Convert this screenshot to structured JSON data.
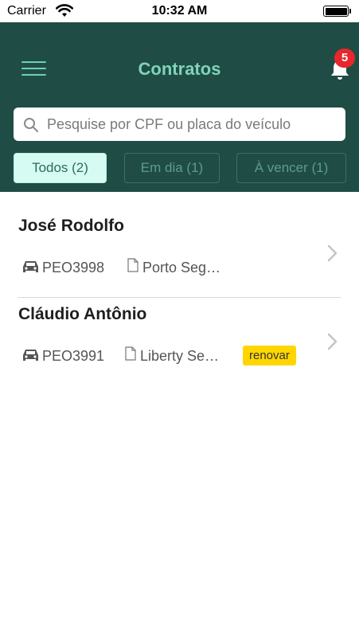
{
  "status_bar": {
    "carrier": "Carrier",
    "time": "10:32 AM"
  },
  "header": {
    "title": "Contratos",
    "notification_count": "5",
    "background_color": "#1f4d45",
    "accent_color": "#7fd4b9"
  },
  "search": {
    "placeholder": "Pesquise por CPF ou placa do veículo",
    "value": ""
  },
  "filters": [
    {
      "label": "Todos (2)",
      "active": true
    },
    {
      "label": "Em dia (1)",
      "active": false
    },
    {
      "label": "À vencer (1)",
      "active": false
    }
  ],
  "contracts": [
    {
      "name": "José Rodolfo",
      "plate": "PEO3998",
      "insurer": "Porto Seg…",
      "tag": ""
    },
    {
      "name": "Cláudio Antônio",
      "plate": "PEO3991",
      "insurer": "Liberty Se…",
      "tag": "renovar"
    }
  ],
  "icons": {
    "menu": "hamburger-menu-icon",
    "bell": "bell-icon",
    "search": "search-icon",
    "car": "car-icon",
    "document": "document-icon",
    "chevron": "chevron-right-icon"
  },
  "colors": {
    "badge": "#e8262b",
    "renew_tag": "#ffd600"
  }
}
